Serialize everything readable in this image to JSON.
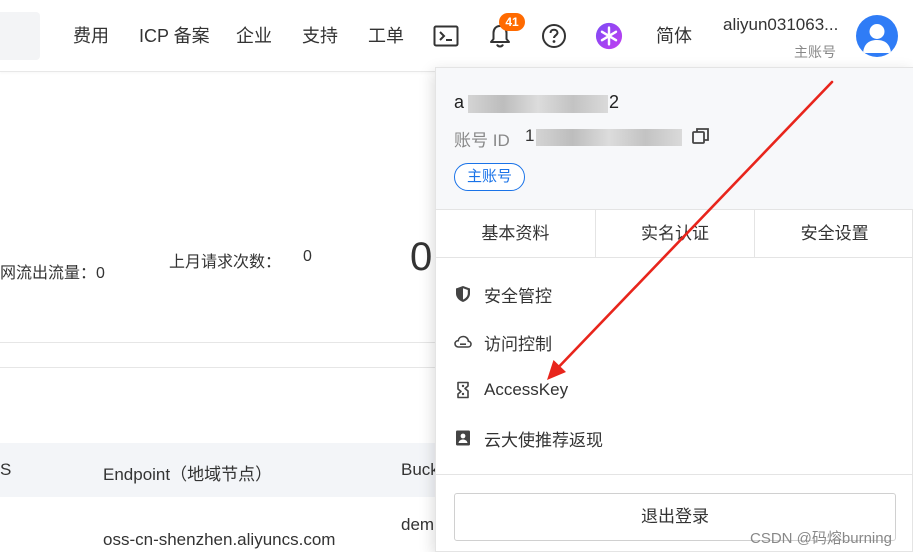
{
  "nav": {
    "links": [
      "费用",
      "ICP 备案",
      "企业",
      "支持",
      "工单"
    ],
    "notifications_count": "41",
    "language": "简体",
    "account_name": "aliyun031063...",
    "account_role": "主账号"
  },
  "page": {
    "outflow_label": "网流出流量：0",
    "requests_label": "上月请求次数：",
    "requests_value": "0",
    "big_value": "0",
    "table_headers": [
      "S",
      "Endpoint（地域节点）",
      "Buck"
    ],
    "table_row": [
      "oss-cn-shenzhen.aliyuncs.com",
      "dem"
    ]
  },
  "dropdown": {
    "name_start": "a",
    "name_end": "2",
    "id_label": "账号 ID",
    "id_start": "1",
    "role_tag": "主账号",
    "tabs": [
      "基本资料",
      "实名认证",
      "安全设置"
    ],
    "items": [
      {
        "label": "安全管控",
        "icon": "shield-icon"
      },
      {
        "label": "访问控制",
        "icon": "cloud-icon"
      },
      {
        "label": "AccessKey",
        "icon": "key-icon"
      },
      {
        "label": "云大使推荐返现",
        "icon": "ambassador-icon"
      }
    ],
    "logout_label": "退出登录"
  },
  "watermark": "CSDN @码熔burning",
  "colors": {
    "accent": "#1a73e8",
    "badge": "#ff6a00",
    "annotation_arrow": "#e8251c"
  }
}
